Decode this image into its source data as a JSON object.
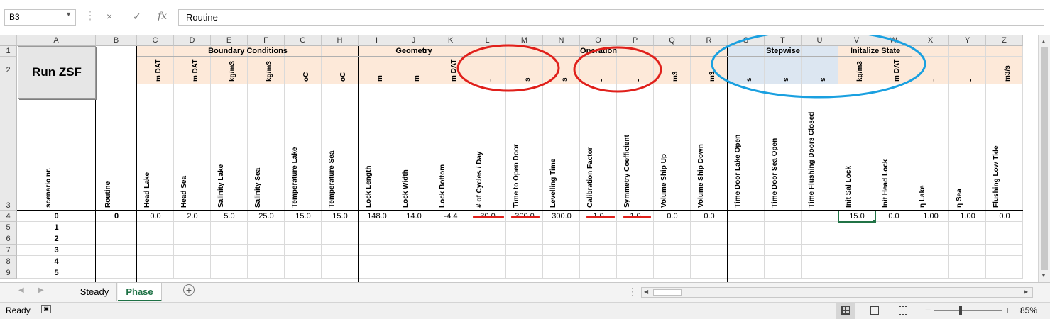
{
  "formula_bar": {
    "name_box": "B3",
    "cancel_icon": "×",
    "enter_icon": "✓",
    "fx_icon": "fx",
    "formula_value": "Routine"
  },
  "columns": [
    "A",
    "B",
    "C",
    "D",
    "E",
    "F",
    "G",
    "H",
    "I",
    "J",
    "K",
    "L",
    "M",
    "N",
    "O",
    "P",
    "Q",
    "R",
    "S",
    "T",
    "U",
    "V",
    "W",
    "X",
    "Y",
    "Z"
  ],
  "rows": [
    "1",
    "2",
    "3",
    "4",
    "5",
    "6",
    "7",
    "8",
    "9"
  ],
  "run_button_label": "Run ZSF",
  "groups": {
    "boundary": "Boundary Conditions",
    "geometry": "Geometry",
    "operation": "Operation",
    "stepwise": "Stepwise",
    "init": "Initalize State"
  },
  "units": [
    "m DAT",
    "m DAT",
    "kg/m3",
    "kg/m3",
    "oC",
    "oC",
    "m",
    "m",
    "m DAT",
    "-",
    "s",
    "s",
    "-",
    "-",
    "m3",
    "m3",
    "s",
    "s",
    "s",
    "kg/m3",
    "m DAT",
    "-",
    "-",
    "m3/s"
  ],
  "headers": [
    "scenario nr.",
    "Routine",
    "Head Lake",
    "Head Sea",
    "Salinity Lake",
    "Salinity Sea",
    "Temperature Lake",
    "Temperature Sea",
    "Lock Length",
    "Lock Width",
    "Lock Bottom",
    "# of Cycles / Day",
    "Time to Open Door",
    "Levelling Time",
    "Calibration Factor",
    "Symmetry Coefficient",
    "Volume Ship Up",
    "Volume Ship Down",
    "Time Door Lake Open",
    "Time Door Sea Open",
    "Time Flushing Doors Closed",
    "Init Sal Lock",
    "Init Head Lock",
    "η Lake",
    "η Sea",
    "Flushing Low Tide"
  ],
  "row4_values": [
    "0",
    "0",
    "0.0",
    "2.0",
    "5.0",
    "25.0",
    "15.0",
    "15.0",
    "148.0",
    "14.0",
    "-4.4",
    "30.0",
    "300.0",
    "300.0",
    "1.0",
    "1.0",
    "0.0",
    "0.0",
    "",
    "",
    "",
    "15.0",
    "0.0",
    "1.00",
    "1.00",
    "0.0"
  ],
  "scenario_numbers": [
    "1",
    "2",
    "3",
    "4",
    "5"
  ],
  "tabs": [
    "Steady",
    "Phase"
  ],
  "status": {
    "ready": "Ready",
    "zoom": "85%"
  },
  "annotation_colors": {
    "red": "#e0201b",
    "blue": "#1aa0e0"
  }
}
